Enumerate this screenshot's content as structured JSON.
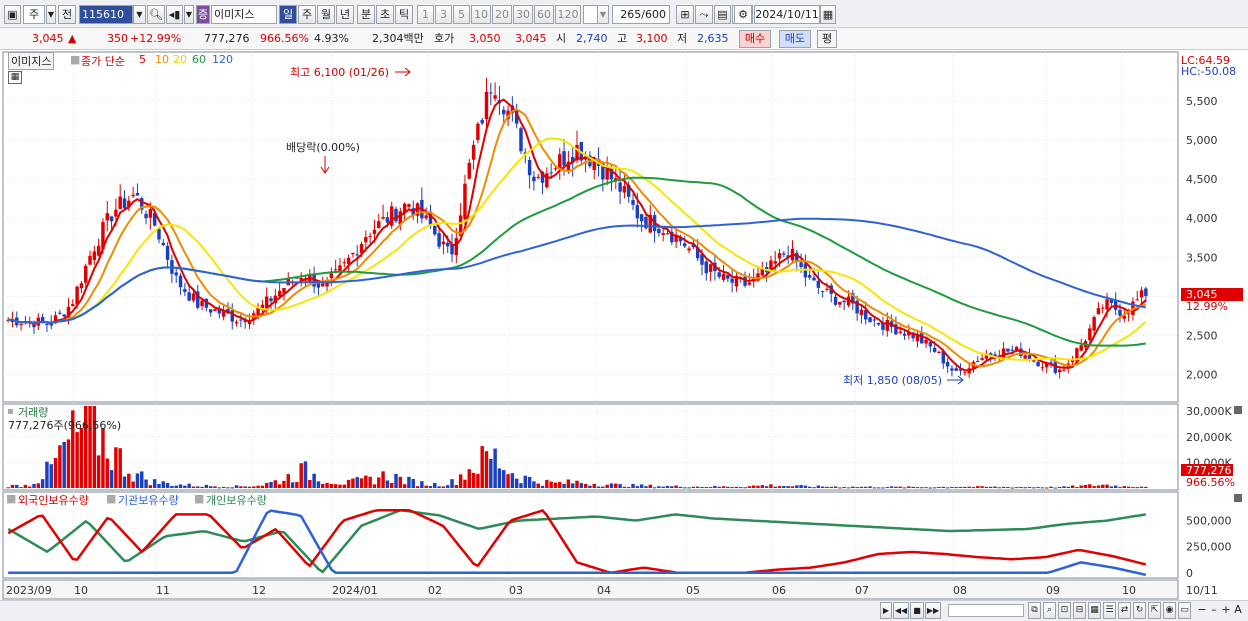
{
  "toolbar": {
    "period_select": "주",
    "prev_label": "전",
    "code": "115610",
    "stock_badge": "증",
    "stock_name": "이미지스",
    "period_buttons": [
      "일",
      "주",
      "월",
      "년",
      "분",
      "초",
      "틱"
    ],
    "interval_buttons": [
      "1",
      "3",
      "5",
      "10",
      "20",
      "30",
      "60",
      "120"
    ],
    "count": "265",
    "count_total": "/600",
    "date": "2024/10/11"
  },
  "info": {
    "price": "3,045",
    "change_arrow": "▲",
    "change": "350",
    "change_pct": "+12.99%",
    "volume": "777,276",
    "volume_ratio": "966.56%",
    "turnover": "4.93%",
    "amount": "2,304백만",
    "quote_label": "호가",
    "ask": "3,050",
    "bid": "3,045",
    "open_label": "시",
    "open": "2,740",
    "high_label": "고",
    "high": "3,100",
    "low_label": "저",
    "low": "2,635",
    "buy_label": "매수",
    "sell_label": "매도",
    "eval_label": "평"
  },
  "colors": {
    "up": "#e00000",
    "down": "#1a3fbf",
    "ma5": "#e00000",
    "ma10": "#f08c00",
    "ma20": "#f6e600",
    "ma60": "#1e9b3c",
    "ma120": "#2f62d6",
    "foreign": "#e00000",
    "institution": "#2f62d6",
    "individual": "#2e8b57"
  },
  "price_panel": {
    "name_tag": "이미지스",
    "legend_prefix": "종가 단순",
    "ma_periods": [
      "5",
      "10",
      "20",
      "60",
      "120"
    ],
    "lc_label": "LC:64.59",
    "hc_label": "HC:-50.08",
    "high_annotation": "최고 6,100 (01/26)",
    "low_annotation": "최저 1,850 (08/05)",
    "dividend_annotation": "배당락(0.00%)",
    "price_tag": "3,045",
    "pct_tag": "12.99%",
    "y_ticks": [
      "5,500",
      "5,000",
      "4,500",
      "4,000",
      "3,500",
      "3,000",
      "2,500",
      "2,000"
    ]
  },
  "volume_panel": {
    "title": "거래량",
    "subtitle": "777,276주(966.56%)",
    "y_ticks": [
      "30,000K",
      "20,000K",
      "10,000K"
    ],
    "value_tag": "777,276",
    "ratio_tag": "966.56%"
  },
  "holding_panel": {
    "legend": [
      "외국인보유수량",
      "기관보유수량",
      "개인보유수량"
    ],
    "y_ticks": [
      "500,000",
      "250,000",
      "0"
    ]
  },
  "x_axis": [
    "2023/09",
    "10",
    "11",
    "12",
    "2024/01",
    "02",
    "03",
    "04",
    "05",
    "06",
    "07",
    "08",
    "09",
    "10",
    "10/11"
  ],
  "chart_data": {
    "type": "candlestick",
    "x_range": [
      "2023/09",
      "2024/10/11"
    ],
    "price_ylim": [
      1700,
      6100
    ],
    "close_profile": [
      2700,
      2680,
      2650,
      2900,
      3600,
      4100,
      4300,
      3900,
      3200,
      2900,
      2800,
      2700,
      2850,
      3100,
      3300,
      3100,
      3400,
      3800,
      4000,
      4200,
      3900,
      3500,
      4800,
      5800,
      5200,
      4500,
      4700,
      4900,
      4700,
      4400,
      4000,
      3900,
      3700,
      3400,
      3200,
      3150,
      3300,
      3600,
      3200,
      3000,
      2900,
      2700,
      2600,
      2500,
      2300,
      2000,
      2200,
      2300,
      2300,
      2150,
      2050,
      2400,
      2900,
      2800,
      3045
    ],
    "volume_ylim": [
      0,
      32000
    ],
    "volume_unit": "K",
    "volume_bars": [
      900,
      1200,
      8000,
      21000,
      28000,
      15000,
      6000,
      2500,
      1500,
      1000,
      800,
      700,
      1200,
      3500,
      7500,
      4000,
      2000,
      3500,
      5500,
      3000,
      1500,
      2000,
      9000,
      14000,
      6000,
      3000,
      2000,
      2500,
      1800,
      1200,
      1000,
      800,
      700,
      600,
      600,
      700,
      1200,
      900,
      700,
      600,
      500,
      500,
      450,
      420,
      400,
      600,
      500,
      450,
      420,
      400,
      400,
      900,
      1400,
      700,
      777
    ],
    "holdings_ylim": [
      -50000,
      650000
    ],
    "foreign_profile": [
      380000,
      560000,
      100000,
      540000,
      200000,
      560000,
      560000,
      230000,
      420000,
      60000,
      500000,
      600000,
      600000,
      450000,
      50000,
      500000,
      600000,
      100000,
      0,
      50000,
      0,
      0,
      0,
      30000,
      50000,
      100000,
      180000,
      200000,
      180000,
      150000,
      130000,
      150000,
      220000,
      160000,
      80000
    ],
    "institution_profile": [
      0,
      0,
      0,
      0,
      0,
      0,
      0,
      0,
      600000,
      550000,
      0,
      0,
      0,
      0,
      0,
      0,
      0,
      0,
      0,
      0,
      0,
      0,
      0,
      0,
      0,
      0,
      0,
      0,
      0,
      0,
      0,
      0,
      0,
      100000,
      50000,
      -20000
    ],
    "individual_profile": [
      420000,
      200000,
      500000,
      100000,
      350000,
      400000,
      300000,
      400000,
      0,
      450000,
      600000,
      550000,
      420000,
      500000,
      520000,
      540000,
      500000,
      560000,
      520000,
      500000,
      480000,
      460000,
      440000,
      420000,
      400000,
      410000,
      420000,
      470000,
      500000,
      560000
    ]
  }
}
